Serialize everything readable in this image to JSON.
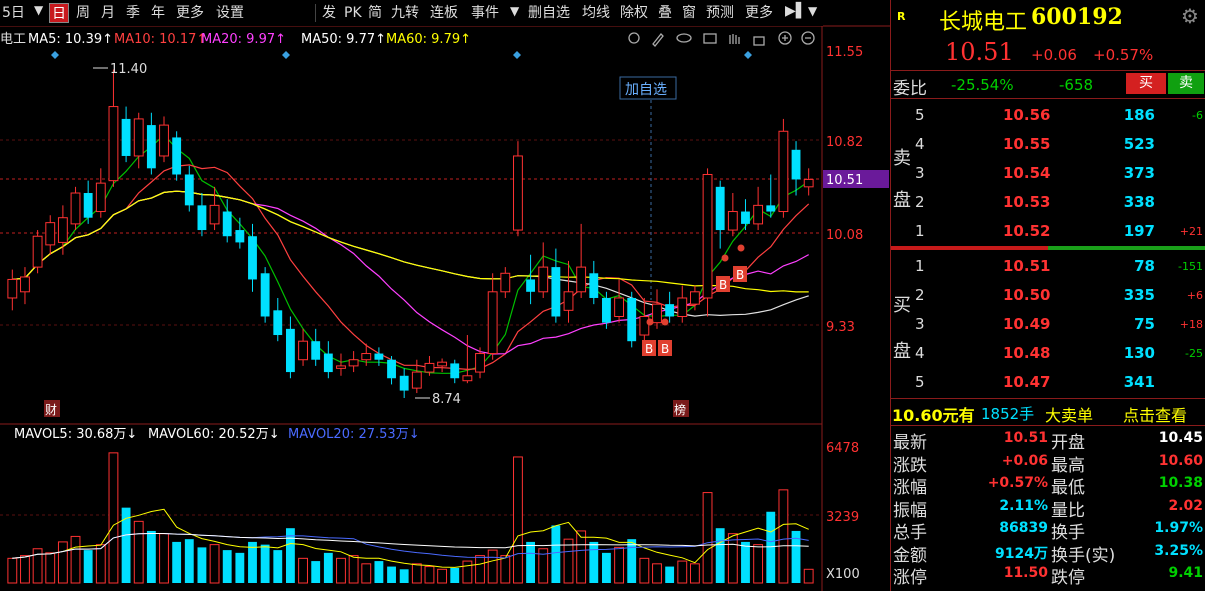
{
  "toolbar": {
    "period_label": "5日",
    "tabs": [
      "日",
      "周",
      "月",
      "季",
      "年"
    ],
    "more_label": "更多",
    "settings_label": "设置",
    "tools": [
      "发",
      "PK",
      "简",
      "九转",
      "连板",
      "事件",
      "删自选",
      "均线",
      "除权",
      "叠",
      "窗",
      "预测",
      "更多"
    ]
  },
  "ma_legend": {
    "stock_short": "电工",
    "ma5": "MA5: 10.39↑",
    "ma10": "MA10: 10.17↑",
    "ma20": "MA20: 9.97↑",
    "ma50": "MA50: 9.77↑",
    "ma60": "MA60: 9.79↑"
  },
  "price_axis": {
    "ticks": [
      "11.55",
      "10.82",
      "10.08",
      "9.33"
    ],
    "current": "10.51"
  },
  "price_annotations": {
    "high": "11.40",
    "low": "8.74",
    "add_watch": "加自选",
    "cai_tag": "财",
    "bang_tag": "榜",
    "b_tag": "B"
  },
  "volume_legend": {
    "mavol5": "MAVOL5: 30.68万↓",
    "mavol60": "MAVOL60: 20.52万↓",
    "mavol20": "MAVOL20: 27.53万↓"
  },
  "volume_axis": {
    "ticks": [
      "6478",
      "3239"
    ],
    "unit": "X100"
  },
  "colors": {
    "up": "#ff3232",
    "down": "#00e0ff",
    "ma5": "#ffffff",
    "ma10": "#ff4040",
    "ma20": "#ff40ff",
    "ma50": "#ffffff",
    "ma60": "#ffff00",
    "accent": "#6a1a9a"
  },
  "quote": {
    "badge": "R",
    "name": "长城电工",
    "code": "600192",
    "price": "10.51",
    "change": "+0.06",
    "change_pct": "+0.57%",
    "weibi_label": "委比",
    "weibi_pct": "-25.54%",
    "weibi_diff": "-658",
    "buy_btn": "买",
    "sell_btn": "卖",
    "sell_side_label": [
      "卖",
      "盘"
    ],
    "buy_side_label": [
      "买",
      "盘"
    ],
    "sells": [
      {
        "level": "5",
        "price": "10.56",
        "vol": "186",
        "delta": "-6"
      },
      {
        "level": "4",
        "price": "10.55",
        "vol": "523",
        "delta": ""
      },
      {
        "level": "3",
        "price": "10.54",
        "vol": "373",
        "delta": ""
      },
      {
        "level": "2",
        "price": "10.53",
        "vol": "338",
        "delta": ""
      },
      {
        "level": "1",
        "price": "10.52",
        "vol": "197",
        "delta": "+21"
      }
    ],
    "buys": [
      {
        "level": "1",
        "price": "10.51",
        "vol": "78",
        "delta": "-151"
      },
      {
        "level": "2",
        "price": "10.50",
        "vol": "335",
        "delta": "+6"
      },
      {
        "level": "3",
        "price": "10.49",
        "vol": "75",
        "delta": "+18"
      },
      {
        "level": "4",
        "price": "10.48",
        "vol": "130",
        "delta": "-25"
      },
      {
        "level": "5",
        "price": "10.47",
        "vol": "341",
        "delta": ""
      }
    ],
    "big_order_price": "10.60元有",
    "big_order_qty": "1852手",
    "big_order_label": "大卖单",
    "big_order_link": "点击查看",
    "stats": [
      {
        "l1": "最新",
        "v1": "10.51",
        "c1": "red",
        "l2": "开盘",
        "v2": "10.45",
        "c2": "white"
      },
      {
        "l1": "涨跌",
        "v1": "+0.06",
        "c1": "red",
        "l2": "最高",
        "v2": "10.60",
        "c2": "red"
      },
      {
        "l1": "涨幅",
        "v1": "+0.57%",
        "c1": "red",
        "l2": "最低",
        "v2": "10.38",
        "c2": "green"
      },
      {
        "l1": "振幅",
        "v1": "2.11%",
        "c1": "cyan",
        "l2": "量比",
        "v2": "2.02",
        "c2": "red"
      },
      {
        "l1": "总手",
        "v1": "86839",
        "c1": "cyan",
        "l2": "换手",
        "v2": "1.97%",
        "c2": "cyan"
      },
      {
        "l1": "金额",
        "v1": "9124万",
        "c1": "cyan",
        "l2": "换手(实)",
        "v2": "3.25%",
        "c2": "cyan"
      },
      {
        "l1": "涨停",
        "v1": "11.50",
        "c1": "red",
        "l2": "跌停",
        "v2": "9.41",
        "c2": "green"
      }
    ]
  }
}
